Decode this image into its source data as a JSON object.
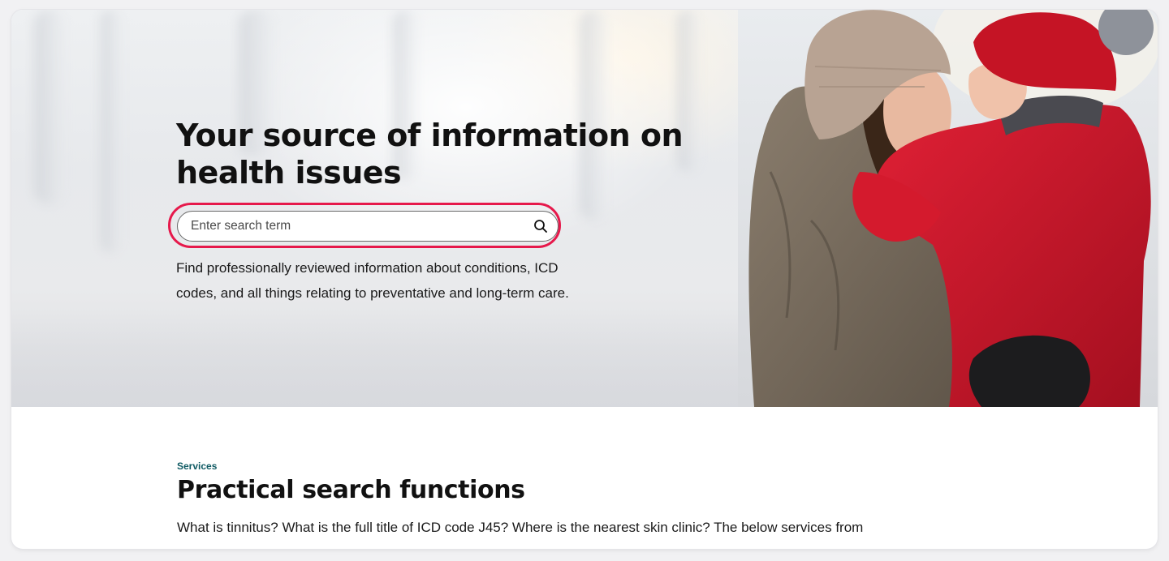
{
  "hero": {
    "title": "Your source of information on health issues",
    "search": {
      "placeholder": "Enter search term",
      "value": "",
      "button_icon": "search-icon"
    },
    "description": "Find professionally reviewed information about conditions, ICD codes, and all things relating to preventative and long-term care.",
    "image_subject": "Mother and child in winter clothing embracing in a snowy forest"
  },
  "services": {
    "eyebrow": "Services",
    "title": "Practical search functions",
    "intro": "What is tinnitus? What is the full title of ICD code J45? Where is the nearest skin clinic? The below services from"
  },
  "colors": {
    "focus_ring": "#e6194b",
    "eyebrow": "#0f5a63",
    "text": "#111111"
  }
}
